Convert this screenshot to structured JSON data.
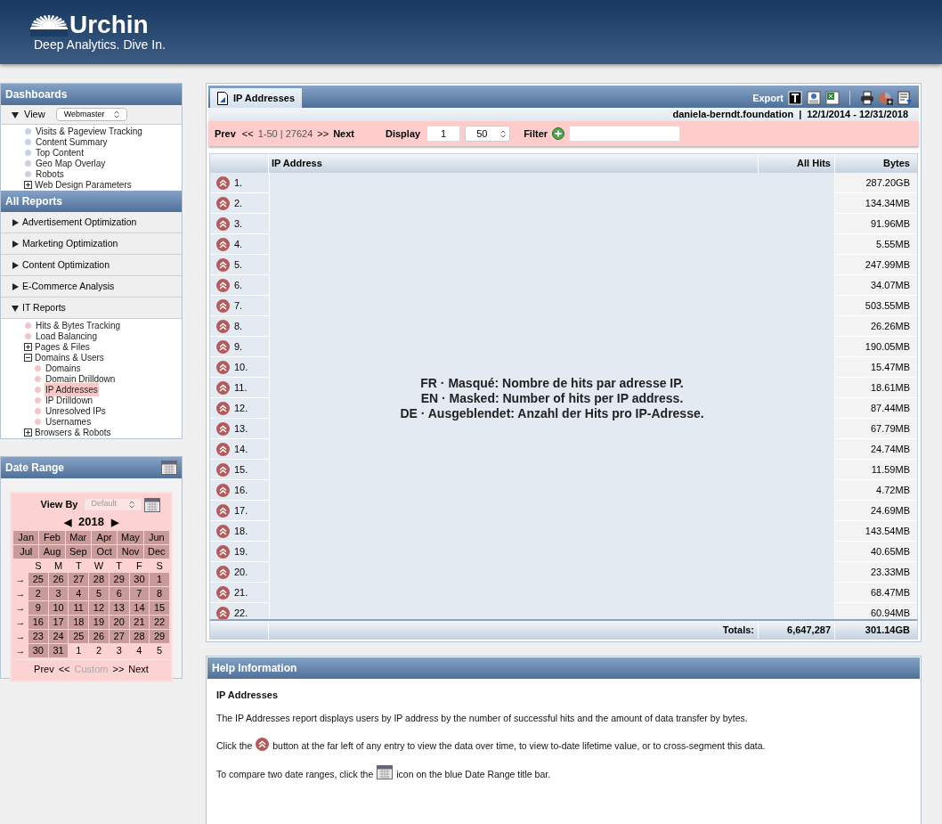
{
  "header": {
    "logo_name": "Urchin",
    "tagline": "Deep Analytics. Dive In."
  },
  "dashboards": {
    "title": "Dashboards",
    "view_label": "View",
    "view_expanded": true,
    "view_select": "Webmaster",
    "items": [
      {
        "label": "Visits & Pageview Tracking",
        "kind": "leaf"
      },
      {
        "label": "Content Summary",
        "kind": "leaf"
      },
      {
        "label": "Top Content",
        "kind": "leaf"
      },
      {
        "label": "Geo Map Overlay",
        "kind": "leaf"
      },
      {
        "label": "Robots",
        "kind": "leaf"
      },
      {
        "label": "Web Design Parameters",
        "kind": "group",
        "expanded": false
      }
    ]
  },
  "all_reports": {
    "title": "All Reports",
    "sections": [
      {
        "label": "Advertisement Optimization",
        "expanded": false
      },
      {
        "label": "Marketing Optimization",
        "expanded": false
      },
      {
        "label": "Content Optimization",
        "expanded": false
      },
      {
        "label": "E-Commerce Analysis",
        "expanded": false
      },
      {
        "label": "IT Reports",
        "expanded": true,
        "children": [
          {
            "label": "Hits & Bytes Tracking",
            "kind": "leaf",
            "selected": false
          },
          {
            "label": "Load Balancing",
            "kind": "leaf",
            "selected": false
          },
          {
            "label": "Pages & Files",
            "kind": "group",
            "expanded": false
          },
          {
            "label": "Domains & Users",
            "kind": "group",
            "expanded": true,
            "children": [
              {
                "label": "Domains",
                "kind": "leaf",
                "selected": false
              },
              {
                "label": "Domain Drilldown",
                "kind": "leaf",
                "selected": false
              },
              {
                "label": "IP Addresses",
                "kind": "leaf",
                "selected": true
              },
              {
                "label": "IP Drilldown",
                "kind": "leaf",
                "selected": false
              },
              {
                "label": "Unresolved IPs",
                "kind": "leaf",
                "selected": false
              },
              {
                "label": "Usernames",
                "kind": "leaf",
                "selected": false
              }
            ]
          },
          {
            "label": "Browsers & Robots",
            "kind": "group",
            "expanded": false
          }
        ]
      }
    ]
  },
  "date_range": {
    "title": "Date Range",
    "view_by_label": "View By",
    "view_by_select": "Default",
    "prev_year_arrow": "◀",
    "year": "2018",
    "next_year_arrow": "▶",
    "months": [
      {
        "label": "Jan",
        "selected": true
      },
      {
        "label": "Feb",
        "selected": true
      },
      {
        "label": "Mar",
        "selected": true
      },
      {
        "label": "Apr",
        "selected": true
      },
      {
        "label": "May",
        "selected": true
      },
      {
        "label": "Jun",
        "selected": true
      },
      {
        "label": "Jul",
        "selected": true
      },
      {
        "label": "Aug",
        "selected": true
      },
      {
        "label": "Sep",
        "selected": true
      },
      {
        "label": "Oct",
        "selected": true
      },
      {
        "label": "Nov",
        "selected": true
      },
      {
        "label": "Dec",
        "selected": true
      }
    ],
    "weekdays": [
      "S",
      "M",
      "T",
      "W",
      "T",
      "F",
      "S"
    ],
    "weeks": [
      {
        "arrow": "→",
        "days": [
          {
            "label": "25",
            "selected": true
          },
          {
            "label": "26",
            "selected": true
          },
          {
            "label": "27",
            "selected": true
          },
          {
            "label": "28",
            "selected": true
          },
          {
            "label": "29",
            "selected": true
          },
          {
            "label": "30",
            "selected": true
          },
          {
            "label": "1",
            "selected": true
          }
        ]
      },
      {
        "arrow": "→",
        "days": [
          {
            "label": "2",
            "selected": true
          },
          {
            "label": "3",
            "selected": true
          },
          {
            "label": "4",
            "selected": true
          },
          {
            "label": "5",
            "selected": true
          },
          {
            "label": "6",
            "selected": true
          },
          {
            "label": "7",
            "selected": true
          },
          {
            "label": "8",
            "selected": true
          }
        ]
      },
      {
        "arrow": "→",
        "days": [
          {
            "label": "9",
            "selected": true
          },
          {
            "label": "10",
            "selected": true
          },
          {
            "label": "11",
            "selected": true
          },
          {
            "label": "12",
            "selected": true
          },
          {
            "label": "13",
            "selected": true
          },
          {
            "label": "14",
            "selected": true
          },
          {
            "label": "15",
            "selected": true
          }
        ]
      },
      {
        "arrow": "→",
        "days": [
          {
            "label": "16",
            "selected": true
          },
          {
            "label": "17",
            "selected": true
          },
          {
            "label": "18",
            "selected": true
          },
          {
            "label": "19",
            "selected": true
          },
          {
            "label": "20",
            "selected": true
          },
          {
            "label": "21",
            "selected": true
          },
          {
            "label": "22",
            "selected": true
          }
        ]
      },
      {
        "arrow": "→",
        "days": [
          {
            "label": "23",
            "selected": true
          },
          {
            "label": "24",
            "selected": true
          },
          {
            "label": "25",
            "selected": true
          },
          {
            "label": "26",
            "selected": true
          },
          {
            "label": "27",
            "selected": true
          },
          {
            "label": "28",
            "selected": true
          },
          {
            "label": "29",
            "selected": true
          }
        ]
      },
      {
        "arrow": "→",
        "days": [
          {
            "label": "30",
            "selected": true
          },
          {
            "label": "31",
            "selected": true
          },
          {
            "label": "1",
            "selected": false
          },
          {
            "label": "2",
            "selected": false
          },
          {
            "label": "3",
            "selected": false
          },
          {
            "label": "4",
            "selected": false
          },
          {
            "label": "5",
            "selected": false
          }
        ]
      }
    ],
    "prev": "Prev",
    "prev_arrows": "<<",
    "custom": "Custom",
    "next_arrows": ">>",
    "next": "Next"
  },
  "report": {
    "tab": "IP Addresses",
    "export_label": "Export",
    "site": "daniela-berndt.foundation",
    "separator": "|",
    "dates": "12/1/2014 - 12/31/2018",
    "pager": {
      "prev": "Prev",
      "prev_arrows": "<<",
      "range": "1-50 | 27624",
      "next_arrows": ">>",
      "next": "Next",
      "display_label": "Display",
      "display_start": "1",
      "display_count": "50",
      "filter_label": "Filter"
    },
    "columns": [
      "IP Address",
      "All Hits",
      "Bytes"
    ],
    "mask_notes": [
      "FR · Masqué: Nombre de hits par adresse IP.",
      "EN · Masked: Number of hits per IP address.",
      "DE · Ausgeblendet: Anzahl der Hits pro IP-Adresse."
    ],
    "rows": [
      {
        "rank": "1.",
        "bytes": "287.20GB"
      },
      {
        "rank": "2.",
        "bytes": "134.34MB"
      },
      {
        "rank": "3.",
        "bytes": "91.96MB"
      },
      {
        "rank": "4.",
        "bytes": "5.55MB"
      },
      {
        "rank": "5.",
        "bytes": "247.99MB"
      },
      {
        "rank": "6.",
        "bytes": "34.07MB"
      },
      {
        "rank": "7.",
        "bytes": "503.55MB"
      },
      {
        "rank": "8.",
        "bytes": "26.26MB"
      },
      {
        "rank": "9.",
        "bytes": "190.05MB"
      },
      {
        "rank": "10.",
        "bytes": "15.47MB"
      },
      {
        "rank": "11.",
        "bytes": "18.61MB"
      },
      {
        "rank": "12.",
        "bytes": "87.44MB"
      },
      {
        "rank": "13.",
        "bytes": "67.79MB"
      },
      {
        "rank": "14.",
        "bytes": "24.74MB"
      },
      {
        "rank": "15.",
        "bytes": "11.59MB"
      },
      {
        "rank": "16.",
        "bytes": "4.72MB"
      },
      {
        "rank": "17.",
        "bytes": "24.69MB"
      },
      {
        "rank": "18.",
        "bytes": "143.54MB"
      },
      {
        "rank": "19.",
        "bytes": "40.65MB"
      },
      {
        "rank": "20.",
        "bytes": "23.33MB"
      },
      {
        "rank": "21.",
        "bytes": "68.47MB"
      },
      {
        "rank": "22.",
        "bytes": "60.94MB"
      }
    ],
    "totals": {
      "label": "Totals:",
      "hits": "6,647,287",
      "bytes": "301.14GB"
    }
  },
  "help": {
    "title": "Help Information",
    "heading": "IP Addresses",
    "paragraphs": [
      {
        "before": "The IP Addresses report displays users by IP address by the number of successful hits and the amount of data transfer by bytes."
      },
      {
        "before": "Click the",
        "after": "button at the far left of any entry to view the data over time, to view to-date lifetime value, or to cross-segment this data."
      },
      {
        "before": "To compare two date ranges, click the",
        "after": "icon on the blue Date Range title bar."
      }
    ]
  }
}
